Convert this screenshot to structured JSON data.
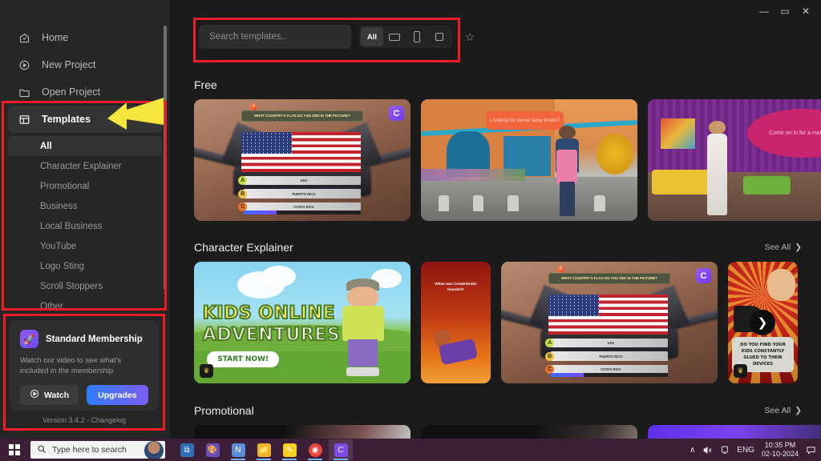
{
  "window": {
    "controls": {
      "minimize": "—",
      "maximize": "▭",
      "close": "✕"
    }
  },
  "sidebar": {
    "nav": [
      {
        "label": "Home",
        "icon": "home-icon",
        "active": false
      },
      {
        "label": "New Project",
        "icon": "play-circle-icon",
        "active": false
      },
      {
        "label": "Open Project",
        "icon": "folder-icon",
        "active": false
      },
      {
        "label": "Templates",
        "icon": "layout-grid-icon",
        "active": true
      }
    ],
    "categories": [
      {
        "label": "All",
        "active": true
      },
      {
        "label": "Character Explainer",
        "active": false
      },
      {
        "label": "Promotional",
        "active": false
      },
      {
        "label": "Business",
        "active": false
      },
      {
        "label": "Local Business",
        "active": false
      },
      {
        "label": "YouTube",
        "active": false
      },
      {
        "label": "Logo Sting",
        "active": false
      },
      {
        "label": "Scroll Stoppers",
        "active": false
      },
      {
        "label": "Other",
        "active": false
      }
    ],
    "membership": {
      "title": "Standard Membership",
      "description": "Watch our video to see what's included in the membership",
      "watch_label": "Watch",
      "upgrades_label": "Upgrades",
      "rocket_icon": "🚀"
    },
    "footer": {
      "version": "Version 3.4.2",
      "separator": "-",
      "changelog": "Changelog"
    }
  },
  "search": {
    "placeholder": "Search templates..",
    "value": "",
    "filter_all": "All",
    "filters": [
      {
        "name": "ratio-landscape",
        "label": ""
      },
      {
        "name": "ratio-portrait",
        "label": ""
      },
      {
        "name": "ratio-square",
        "label": ""
      }
    ],
    "favorite_icon": "☆"
  },
  "sections": [
    {
      "title": "Free",
      "see_all": "",
      "cards": [
        {
          "name": "template-card-flag-quiz",
          "type": "quiz",
          "question": "WHAT COUNTRY'S FLAG DO YOU SEE IN THE PICTURE?",
          "options": [
            "USA",
            "PUERTO RICO",
            "COSTA RICA"
          ],
          "option_letters": [
            "A",
            "B",
            "C"
          ],
          "has_logo_badge": true,
          "has_crown": false
        },
        {
          "name": "template-card-cafe",
          "type": "cafe",
          "caption": "Looking for some tasty treats?",
          "has_logo_badge": false,
          "has_crown": false
        },
        {
          "name": "template-card-salon",
          "type": "salon",
          "caption": "Come on in for a makeover!",
          "has_logo_badge": false,
          "has_crown": false,
          "has_next_arrow": true
        }
      ]
    },
    {
      "title": "Character Explainer",
      "see_all": "See All",
      "cards": [
        {
          "name": "template-card-kids-online-adventures",
          "type": "kids",
          "title_line1": "KIDS ONLINE",
          "title_line2": "ADVENTURES",
          "button": "START NOW!",
          "has_crown": true
        },
        {
          "name": "template-card-founded",
          "type": "founded",
          "caption": "When was CreateStudio founded?",
          "has_crown": false
        },
        {
          "name": "template-card-flag-quiz-2",
          "type": "quiz",
          "question": "WHAT COUNTRY'S FLAG DO YOU SEE IN THE PICTURE?",
          "options": [
            "USA",
            "PUERTO RICO",
            "COSTA RICA"
          ],
          "option_letters": [
            "A",
            "B",
            "C"
          ],
          "has_logo_badge": true,
          "has_crown": false
        },
        {
          "name": "template-card-devices",
          "type": "devices",
          "caption": "DO YOU FIND YOUR KIDS CONSTANTLY GLUED TO THEIR DEVICES",
          "has_crown": true,
          "has_next_arrow": true
        }
      ]
    },
    {
      "title": "Promotional",
      "see_all": "See All",
      "cards": []
    }
  ],
  "taskbar": {
    "search_placeholder": "Type here to search",
    "apps": [
      {
        "name": "taskview-icon",
        "glyph": "⧉",
        "color": "#4a90d9"
      },
      {
        "name": "paint-icon",
        "glyph": "🎨",
        "color": "#7a5ec4"
      },
      {
        "name": "onenote-icon",
        "glyph": "N",
        "color": "#5b8dd9"
      },
      {
        "name": "file-explorer-icon",
        "glyph": "📁",
        "color": "#f0b429"
      },
      {
        "name": "sticky-notes-icon",
        "glyph": "✎",
        "color": "#f5d020"
      },
      {
        "name": "chrome-icon",
        "glyph": "◉",
        "color": "#e8453c"
      },
      {
        "name": "createstudio-icon",
        "glyph": "C",
        "color": "#7b4ae8"
      }
    ],
    "tray": {
      "chevron": "∧",
      "volume_icon": "🔊",
      "network_icon": "▣",
      "language": "ENG",
      "time": "10:35 PM",
      "date": "02-10-2024",
      "notification_icon": "💬"
    }
  },
  "annotations": {
    "arrow_color": "#f5e63d",
    "box_color": "#ee1c25"
  }
}
